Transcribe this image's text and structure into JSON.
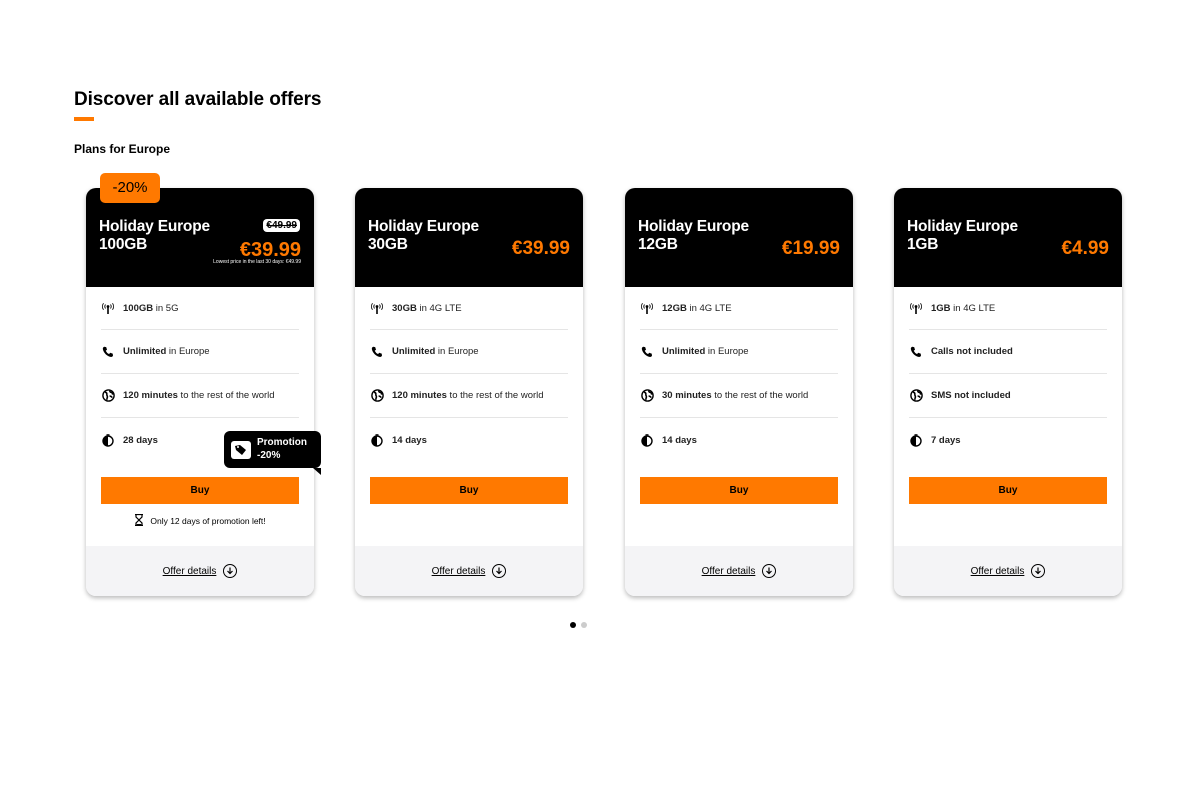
{
  "header": {
    "title": "Discover all available offers",
    "section_title": "Plans for Europe"
  },
  "colors": {
    "accent": "#ff7900",
    "card_header": "#000000",
    "footer_bg": "#f4f4f6"
  },
  "plans": [
    {
      "name_line1": "Holiday Europe",
      "name_line2": "100GB",
      "price": "€39.99",
      "old_price": "€49.99",
      "lowest_price_note": "Lowest price in the last 30 days: €49.99",
      "discount_badge": "-20%",
      "features": [
        {
          "icon": "signal-icon",
          "bold": "100GB",
          "text": " in 5G"
        },
        {
          "icon": "phone-icon",
          "bold": "Unlimited",
          "text": " in Europe"
        },
        {
          "icon": "globe-icon",
          "bold": "120 minutes",
          "text": " to the rest of the world"
        },
        {
          "icon": "clock-icon",
          "bold": "28 days",
          "text": ""
        }
      ],
      "promo_tooltip": {
        "line1": "Promotion",
        "line2": "-20%",
        "icon": "tag-icon"
      },
      "buy_label": "Buy",
      "promo_left": "Only 12 days of promotion left!",
      "offer_details": "Offer details"
    },
    {
      "name_line1": "Holiday Europe",
      "name_line2": "30GB",
      "price": "€39.99",
      "features": [
        {
          "icon": "signal-icon",
          "bold": "30GB",
          "text": " in 4G LTE"
        },
        {
          "icon": "phone-icon",
          "bold": "Unlimited",
          "text": " in Europe"
        },
        {
          "icon": "globe-icon",
          "bold": "120 minutes",
          "text": " to the rest of the world"
        },
        {
          "icon": "clock-icon",
          "bold": "14 days",
          "text": ""
        }
      ],
      "buy_label": "Buy",
      "offer_details": "Offer details"
    },
    {
      "name_line1": "Holiday Europe",
      "name_line2": "12GB",
      "price": "€19.99",
      "features": [
        {
          "icon": "signal-icon",
          "bold": "12GB",
          "text": " in 4G LTE"
        },
        {
          "icon": "phone-icon",
          "bold": "Unlimited",
          "text": " in Europe"
        },
        {
          "icon": "globe-icon",
          "bold": "30 minutes",
          "text": " to the rest of the world"
        },
        {
          "icon": "clock-icon",
          "bold": "14 days",
          "text": ""
        }
      ],
      "buy_label": "Buy",
      "offer_details": "Offer details"
    },
    {
      "name_line1": "Holiday Europe",
      "name_line2": "1GB",
      "price": "€4.99",
      "features": [
        {
          "icon": "signal-icon",
          "bold": "1GB",
          "text": " in 4G LTE"
        },
        {
          "icon": "phone-icon",
          "bold": "Calls not included",
          "text": ""
        },
        {
          "icon": "globe-icon",
          "bold": "SMS not included",
          "text": ""
        },
        {
          "icon": "clock-icon",
          "bold": "7 days",
          "text": ""
        }
      ],
      "buy_label": "Buy",
      "offer_details": "Offer details"
    }
  ],
  "pagination": {
    "total": 2,
    "active": 1
  }
}
